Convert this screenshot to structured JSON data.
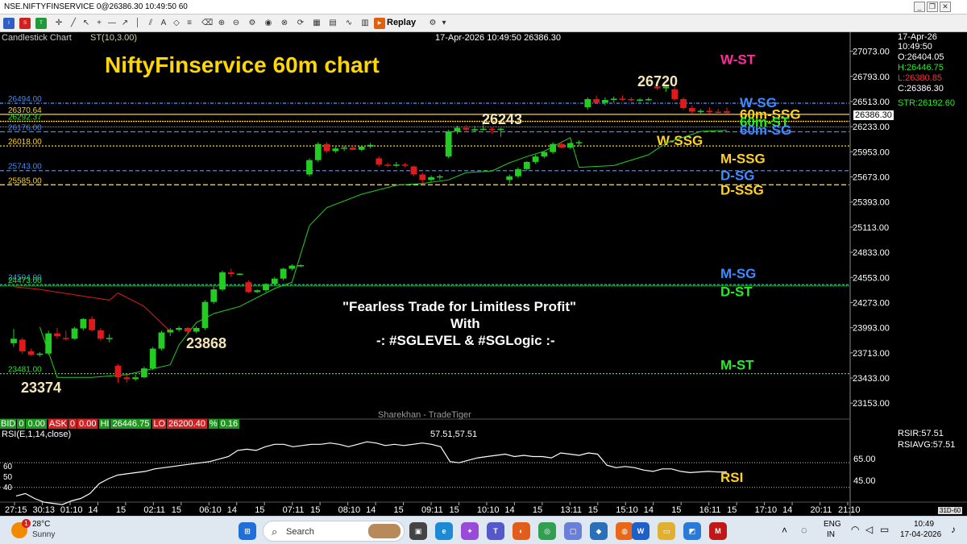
{
  "window": {
    "title": "NSE.NIFTYFINSERVICE 0@26386.30 10:49:50 60"
  },
  "toolbar": {
    "replay_label": "Replay"
  },
  "chart_header": {
    "chart_type_label": "Candlestick Chart",
    "indicator_label": "ST(10,3.00)",
    "center_label": "17-Apr-2026 10:49:50 26386.30"
  },
  "ohlc": {
    "date": "17-Apr-26",
    "time": "10:49:50",
    "open": "O:26404.05",
    "high": "H:26446.75",
    "low": "L:26380.85",
    "close": "C:26386.30",
    "str": "STR:26192.60",
    "last": "26386.30"
  },
  "annotations": {
    "title": "NiftyFinservice 60m chart",
    "tagline_1": "\"Fearless Trade for Limitless Profit\"",
    "tagline_2": "With",
    "tagline_3": "-: #SGLEVEL & #SGLogic :-",
    "watermark": "Sharekhan - TradeTiger",
    "peak_label": "26720",
    "mid_high_label": "26243",
    "low_label_1": "23374",
    "low_label_2": "23868"
  },
  "level_labels": [
    {
      "text": "W-ST",
      "color": "#ff2d9b"
    },
    {
      "text": "W-SG",
      "color": "#3d8bff"
    },
    {
      "text": "60m-SSG",
      "color": "#ffd21f"
    },
    {
      "text": "60m-ST",
      "color": "#22ee22"
    },
    {
      "text": "60m-SG",
      "color": "#3d8bff"
    },
    {
      "text": "W-SSG",
      "color": "#ffd21f"
    },
    {
      "text": "M-SSG",
      "color": "#ffd21f"
    },
    {
      "text": "D-SG",
      "color": "#3d8bff"
    },
    {
      "text": "D-SSG",
      "color": "#ffd21f"
    },
    {
      "text": "M-SG",
      "color": "#3d8bff"
    },
    {
      "text": "D-ST",
      "color": "#22ee22"
    },
    {
      "text": "M-ST",
      "color": "#22ee22"
    }
  ],
  "bid_ask": {
    "bid_label": "BID",
    "bid_qty": "0",
    "bid_price": "0.00",
    "ask_label": "ASK",
    "ask_qty": "0",
    "ask_price": "0.00",
    "hi_label": "HI",
    "hi_value": "26446.75",
    "lo_label": "LO",
    "lo_value": "26200.40",
    "pct_label": "%",
    "pct_value": "0.16"
  },
  "rsi": {
    "label": "RSI(E,1,14,close)",
    "center_value": "57.51,57.51",
    "rsir": "RSIR:57.51",
    "rsiavg": "RSIAVG:57.51",
    "annotation": "RSI",
    "right_ticks": [
      "65.00",
      "45.00"
    ],
    "left_ticks": [
      "60",
      "50",
      "40"
    ],
    "timeframe": "31D-60"
  },
  "taskbar": {
    "weather_temp": "28°C",
    "weather_desc": "Sunny",
    "search_placeholder": "Search",
    "lang_1": "ENG",
    "lang_2": "IN",
    "time": "10:49",
    "date": "17-04-2026",
    "notif_badge": "1"
  },
  "colors": {
    "bull": "#22cc22",
    "bear": "#e01a1a",
    "st_red": "#e01a1a",
    "st_green": "#22cc22",
    "title_yellow": "#ffd700",
    "blue_level": "#3d8bff",
    "yellow_level": "#ffd21f",
    "green_level": "#22ee22"
  },
  "chart_data": {
    "type": "candlestick",
    "ylim": [
      22993,
      27213
    ],
    "y_ticks": [
      27073,
      26793,
      26513,
      26233,
      25953,
      25673,
      25393,
      25113,
      24833,
      24553,
      24273,
      23993,
      23713,
      23433,
      23153
    ],
    "x_ticks": [
      "27:15",
      "30:13",
      "01:10",
      "14",
      "15",
      "02:11",
      "15",
      "06:10",
      "14",
      "15",
      "07:11",
      "15",
      "08:10",
      "14",
      "15",
      "09:11",
      "15",
      "10:10",
      "14",
      "15",
      "13:11",
      "15",
      "15:10",
      "14",
      "15",
      "16:11",
      "15",
      "17:10",
      "14",
      "20:11",
      "21:10"
    ],
    "left_level_labels": [
      {
        "text": "26494.00",
        "value": 26494,
        "color": "#3d8bff"
      },
      {
        "text": "26370.64",
        "value": 26370,
        "color": "#ffd21f"
      },
      {
        "text": "26292.37",
        "value": 26292,
        "color": "#22ee22"
      },
      {
        "text": "26176.00",
        "value": 26176,
        "color": "#3d8bff"
      },
      {
        "text": "26018.00",
        "value": 26018,
        "color": "#ffd21f"
      },
      {
        "text": "25743.00",
        "value": 25743,
        "color": "#3d8bff"
      },
      {
        "text": "25585.00",
        "value": 25585,
        "color": "#ffd21f"
      },
      {
        "text": "24504.00",
        "value": 24504,
        "color": "#3d8bff"
      },
      {
        "text": "24473.00",
        "value": 24473,
        "color": "#22ee22"
      },
      {
        "text": "23481.00",
        "value": 23481,
        "color": "#22ee22"
      }
    ],
    "candles": [
      {
        "o": 23820,
        "h": 23980,
        "l": 23780,
        "c": 23870
      },
      {
        "o": 23860,
        "h": 23880,
        "l": 23700,
        "c": 23730
      },
      {
        "o": 23730,
        "h": 23760,
        "l": 23680,
        "c": 23690
      },
      {
        "o": 23690,
        "h": 23720,
        "l": 23670,
        "c": 23705
      },
      {
        "o": 23705,
        "h": 23960,
        "l": 23690,
        "c": 23930
      },
      {
        "o": 23930,
        "h": 23990,
        "l": 23870,
        "c": 23900
      },
      {
        "o": 23880,
        "h": 23960,
        "l": 23850,
        "c": 23870
      },
      {
        "o": 23870,
        "h": 24000,
        "l": 23860,
        "c": 23985
      },
      {
        "o": 23985,
        "h": 24100,
        "l": 23960,
        "c": 24090
      },
      {
        "o": 24090,
        "h": 24120,
        "l": 23950,
        "c": 23965
      },
      {
        "o": 23965,
        "h": 23990,
        "l": 23850,
        "c": 23870
      },
      {
        "o": 23870,
        "h": 23920,
        "l": 23830,
        "c": 23880
      },
      {
        "o": 23570,
        "h": 23590,
        "l": 23380,
        "c": 23440
      },
      {
        "o": 23440,
        "h": 23470,
        "l": 23380,
        "c": 23420
      },
      {
        "o": 23420,
        "h": 23470,
        "l": 23400,
        "c": 23440
      },
      {
        "o": 23440,
        "h": 23560,
        "l": 23430,
        "c": 23540
      },
      {
        "o": 23540,
        "h": 23780,
        "l": 23520,
        "c": 23760
      },
      {
        "o": 23760,
        "h": 23960,
        "l": 23740,
        "c": 23940
      },
      {
        "o": 23940,
        "h": 23990,
        "l": 23900,
        "c": 23970
      },
      {
        "o": 23970,
        "h": 24010,
        "l": 23950,
        "c": 23990
      },
      {
        "o": 23990,
        "h": 24000,
        "l": 23930,
        "c": 23950
      },
      {
        "o": 23950,
        "h": 24010,
        "l": 23930,
        "c": 23990
      },
      {
        "o": 23990,
        "h": 24300,
        "l": 23970,
        "c": 24280
      },
      {
        "o": 24280,
        "h": 24450,
        "l": 24260,
        "c": 24420
      },
      {
        "o": 24420,
        "h": 24630,
        "l": 24400,
        "c": 24610
      },
      {
        "o": 24610,
        "h": 24650,
        "l": 24560,
        "c": 24590
      },
      {
        "o": 24590,
        "h": 24600,
        "l": 24580,
        "c": 24595
      },
      {
        "o": 24500,
        "h": 24520,
        "l": 24380,
        "c": 24390
      },
      {
        "o": 24390,
        "h": 24420,
        "l": 24380,
        "c": 24410
      },
      {
        "o": 24410,
        "h": 24490,
        "l": 24390,
        "c": 24480
      },
      {
        "o": 24480,
        "h": 24560,
        "l": 24470,
        "c": 24540
      },
      {
        "o": 24540,
        "h": 24660,
        "l": 24520,
        "c": 24650
      },
      {
        "o": 24650,
        "h": 24700,
        "l": 24630,
        "c": 24685
      },
      {
        "o": 24680,
        "h": 24700,
        "l": 24670,
        "c": 24690
      },
      {
        "o": 25700,
        "h": 25880,
        "l": 25680,
        "c": 25860
      },
      {
        "o": 25860,
        "h": 26060,
        "l": 25840,
        "c": 26040
      },
      {
        "o": 26040,
        "h": 26060,
        "l": 25940,
        "c": 25960
      },
      {
        "o": 25960,
        "h": 26010,
        "l": 25940,
        "c": 25990
      },
      {
        "o": 25990,
        "h": 26020,
        "l": 25960,
        "c": 26000
      },
      {
        "o": 26000,
        "h": 26030,
        "l": 25970,
        "c": 25975
      },
      {
        "o": 25975,
        "h": 26020,
        "l": 25960,
        "c": 26010
      },
      {
        "o": 26010,
        "h": 26050,
        "l": 25990,
        "c": 26030
      },
      {
        "o": 25880,
        "h": 25900,
        "l": 25790,
        "c": 25810
      },
      {
        "o": 25810,
        "h": 25830,
        "l": 25780,
        "c": 25800
      },
      {
        "o": 25800,
        "h": 25840,
        "l": 25780,
        "c": 25810
      },
      {
        "o": 25810,
        "h": 25830,
        "l": 25780,
        "c": 25805
      },
      {
        "o": 25790,
        "h": 25800,
        "l": 25680,
        "c": 25700
      },
      {
        "o": 25700,
        "h": 25720,
        "l": 25600,
        "c": 25640
      },
      {
        "o": 25640,
        "h": 25690,
        "l": 25620,
        "c": 25670
      },
      {
        "o": 25670,
        "h": 25700,
        "l": 25640,
        "c": 25680
      },
      {
        "o": 25900,
        "h": 26200,
        "l": 25880,
        "c": 26180
      },
      {
        "o": 26180,
        "h": 26243,
        "l": 26150,
        "c": 26220
      },
      {
        "o": 26220,
        "h": 26250,
        "l": 26190,
        "c": 26200
      },
      {
        "o": 26200,
        "h": 26240,
        "l": 26180,
        "c": 26205
      },
      {
        "o": 26205,
        "h": 26260,
        "l": 26190,
        "c": 26210
      },
      {
        "o": 26210,
        "h": 26230,
        "l": 26150,
        "c": 26200
      },
      {
        "o": 26200,
        "h": 26220,
        "l": 26120,
        "c": 26210
      },
      {
        "o": 25640,
        "h": 25700,
        "l": 25600,
        "c": 25680
      },
      {
        "o": 25680,
        "h": 25780,
        "l": 25660,
        "c": 25760
      },
      {
        "o": 25760,
        "h": 25850,
        "l": 25740,
        "c": 25840
      },
      {
        "o": 25840,
        "h": 25920,
        "l": 25820,
        "c": 25900
      },
      {
        "o": 25900,
        "h": 25960,
        "l": 25880,
        "c": 25950
      },
      {
        "o": 25950,
        "h": 26060,
        "l": 25930,
        "c": 26040
      },
      {
        "o": 26040,
        "h": 26070,
        "l": 25990,
        "c": 26000
      },
      {
        "o": 26000,
        "h": 26060,
        "l": 25980,
        "c": 26050
      },
      {
        "o": 26050,
        "h": 26080,
        "l": 26020,
        "c": 26060
      },
      {
        "o": 26450,
        "h": 26560,
        "l": 26420,
        "c": 26540
      },
      {
        "o": 26540,
        "h": 26580,
        "l": 26490,
        "c": 26500
      },
      {
        "o": 26500,
        "h": 26560,
        "l": 26470,
        "c": 26530
      },
      {
        "o": 26530,
        "h": 26570,
        "l": 26500,
        "c": 26545
      },
      {
        "o": 26545,
        "h": 26580,
        "l": 26520,
        "c": 26540
      },
      {
        "o": 26540,
        "h": 26560,
        "l": 26510,
        "c": 26530
      },
      {
        "o": 26530,
        "h": 26550,
        "l": 26510,
        "c": 26535
      },
      {
        "o": 26535,
        "h": 26560,
        "l": 26520,
        "c": 26540
      },
      {
        "o": 26680,
        "h": 26720,
        "l": 26640,
        "c": 26660
      },
      {
        "o": 26660,
        "h": 26700,
        "l": 26620,
        "c": 26680
      },
      {
        "o": 26650,
        "h": 26680,
        "l": 26520,
        "c": 26540
      },
      {
        "o": 26540,
        "h": 26560,
        "l": 26420,
        "c": 26440
      },
      {
        "o": 26440,
        "h": 26470,
        "l": 26380,
        "c": 26400
      },
      {
        "o": 26400,
        "h": 26430,
        "l": 26370,
        "c": 26410
      },
      {
        "o": 26410,
        "h": 26450,
        "l": 26380,
        "c": 26400
      },
      {
        "o": 26400,
        "h": 26430,
        "l": 26370,
        "c": 26390
      },
      {
        "o": 26404,
        "h": 26447,
        "l": 26381,
        "c": 26386
      }
    ],
    "supertrend": {
      "red_points": [
        [
          0,
          24450
        ],
        [
          3,
          24420
        ],
        [
          11,
          24300
        ],
        [
          12,
          24380
        ],
        [
          15,
          24230
        ],
        [
          18,
          23950
        ]
      ],
      "green_points": [
        [
          3,
          24000
        ],
        [
          5,
          23440
        ],
        [
          9,
          23440
        ],
        [
          13,
          23470
        ],
        [
          18,
          23580
        ],
        [
          19,
          23800
        ],
        [
          21,
          24050
        ],
        [
          23,
          24150
        ],
        [
          26,
          24230
        ],
        [
          30,
          24430
        ],
        [
          32,
          24500
        ],
        [
          34,
          25130
        ],
        [
          36,
          25330
        ],
        [
          40,
          25480
        ],
        [
          44,
          25580
        ],
        [
          47,
          25600
        ],
        [
          50,
          25640
        ],
        [
          52,
          25720
        ],
        [
          55,
          25740
        ],
        [
          57,
          25830
        ],
        [
          59,
          25900
        ],
        [
          61,
          25960
        ],
        [
          64,
          26110
        ],
        [
          65,
          25780
        ],
        [
          69,
          25800
        ],
        [
          73,
          25920
        ],
        [
          75,
          26050
        ],
        [
          79,
          26180
        ],
        [
          82,
          26192
        ]
      ]
    },
    "rsi_series": [
      38,
      40,
      36,
      33,
      32,
      31,
      34,
      36,
      40,
      48,
      52,
      55,
      56,
      57,
      58,
      60,
      61,
      62,
      63,
      64,
      65,
      66,
      68,
      70,
      75,
      76,
      75,
      78,
      80,
      80,
      78,
      79,
      80,
      80,
      81,
      80,
      78,
      80,
      82,
      81,
      79,
      80,
      79,
      80,
      81,
      80,
      78,
      66,
      65,
      67,
      69,
      70,
      71,
      72,
      70,
      71,
      70,
      70,
      69,
      73,
      72,
      71,
      73,
      72,
      63,
      61,
      62,
      61,
      59,
      58,
      60,
      60,
      58,
      57,
      57.5,
      58,
      57.5,
      57.51
    ],
    "rsi_ylim": [
      35,
      90
    ]
  }
}
